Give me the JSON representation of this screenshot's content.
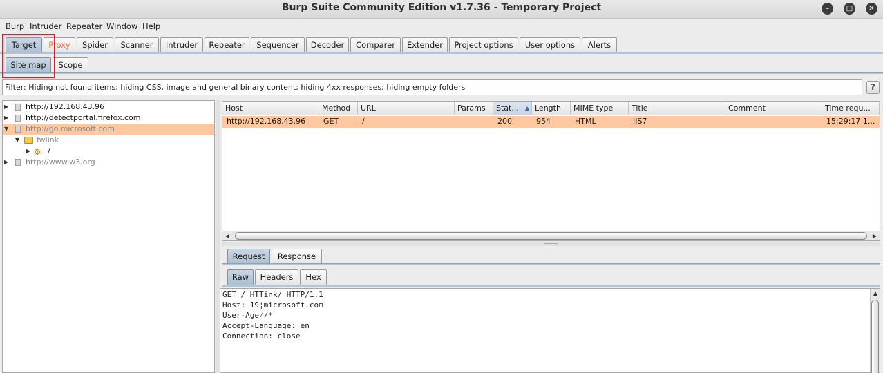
{
  "window": {
    "title": "Burp Suite Community Edition v1.7.36 - Temporary Project",
    "minimize_icon": "minimize-icon",
    "maximize_icon": "maximize-icon",
    "close_icon": "close-icon"
  },
  "menu": [
    "Burp",
    "Intruder",
    "Repeater",
    "Window",
    "Help"
  ],
  "main_tabs": [
    {
      "label": "Target",
      "active": true
    },
    {
      "label": "Proxy",
      "highlighted": true
    },
    {
      "label": "Spider"
    },
    {
      "label": "Scanner"
    },
    {
      "label": "Intruder"
    },
    {
      "label": "Repeater"
    },
    {
      "label": "Sequencer"
    },
    {
      "label": "Decoder"
    },
    {
      "label": "Comparer"
    },
    {
      "label": "Extender"
    },
    {
      "label": "Project options"
    },
    {
      "label": "User options"
    },
    {
      "label": "Alerts"
    }
  ],
  "sub_tabs": [
    {
      "label": "Site map",
      "active": true
    },
    {
      "label": "Scope"
    }
  ],
  "filter": {
    "text": "Filter: Hiding not found items;  hiding CSS, image and general binary content;  hiding 4xx responses;  hiding empty folders",
    "help_label": "?"
  },
  "site_tree": [
    {
      "label": "http://192.168.43.96",
      "icon": "page-icon",
      "expanded": false
    },
    {
      "label": "http://detectportal.firefox.com",
      "icon": "page-icon",
      "expanded": false
    },
    {
      "label": "http://go.microsoft.com",
      "icon": "page-icon",
      "expanded": true,
      "selected": true,
      "greyed": true
    },
    {
      "label": "fwlink",
      "icon": "folder-icon",
      "expanded": true,
      "greyed": true
    },
    {
      "label": "/",
      "icon": "gear-icon",
      "expanded": false
    },
    {
      "label": "http://www.w3.org",
      "icon": "page-icon",
      "expanded": false,
      "greyed": true
    }
  ],
  "table": {
    "columns": [
      "Host",
      "Method",
      "URL",
      "Params",
      "Stat...",
      "Length",
      "MIME type",
      "Title",
      "Comment",
      "Time requ..."
    ],
    "sorted_column": "Stat...",
    "sort_icon": "sort-ascending-icon",
    "rows": [
      [
        "http://192.168.43.96",
        "GET",
        "/",
        "",
        "200",
        "954",
        "HTML",
        "IIS7",
        "",
        "15:29:17 1..."
      ]
    ]
  },
  "message_tabs": [
    {
      "label": "Request",
      "active": true
    },
    {
      "label": "Response"
    }
  ],
  "view_tabs": [
    {
      "label": "Raw",
      "active": true
    },
    {
      "label": "Headers"
    },
    {
      "label": "Hex"
    }
  ],
  "request_text": "GET / HTTink/ HTTP/1.1\nHost: 19¦microsoft.com\nUser-Age⁄/*\nAccept-Language: en\nConnection: close",
  "colors": {
    "selected_row": "#ffc8a0",
    "active_tab": "#aebfd1",
    "proxy_tab_text": "#ff6633",
    "annotation_box": "#e02020"
  }
}
